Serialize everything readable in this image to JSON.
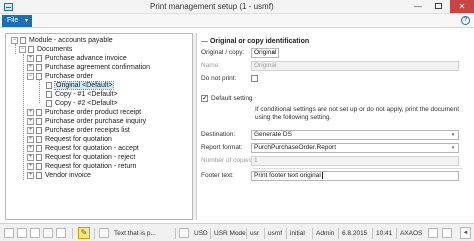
{
  "window": {
    "title": "Print management setup (1 - usmf)",
    "icons": {
      "app": "form-icon",
      "minimize": "minimize-icon",
      "maximize": "maximize-icon",
      "close": "close-icon"
    },
    "minimize_glyph": "—",
    "close_glyph": "✕"
  },
  "menu": {
    "file_label": "File",
    "file_caret": "▾",
    "help_glyph": "?"
  },
  "tree": {
    "items": [
      {
        "label": "Module - accounts payable",
        "toggle": "−"
      },
      {
        "label": "Documents",
        "toggle": "−"
      },
      {
        "label": "Purchase advance invoice",
        "toggle": "+"
      },
      {
        "label": "Purchase agreement confirmation",
        "toggle": "+"
      },
      {
        "label": "Purchase order",
        "toggle": "−"
      },
      {
        "label": "Original <Default>"
      },
      {
        "label": "Copy - #1 <Default>"
      },
      {
        "label": "Copy - #2 <Default>"
      },
      {
        "label": "Purchase order product receipt",
        "toggle": "+"
      },
      {
        "label": "Purchase order purchase inquiry",
        "toggle": "+"
      },
      {
        "label": "Purchase order receipts list",
        "toggle": "+"
      },
      {
        "label": "Request for quotation",
        "toggle": "+"
      },
      {
        "label": "Request for quotation - accept",
        "toggle": "+"
      },
      {
        "label": "Request for quotation - reject",
        "toggle": "+"
      },
      {
        "label": "Request for quotation - return",
        "toggle": "+"
      },
      {
        "label": "Vendor invoice",
        "toggle": "+"
      }
    ]
  },
  "detail": {
    "section_title": "Original or copy identification",
    "section_title_sep": "—",
    "original_copy": {
      "label": "Original / copy:",
      "value": "Original",
      "caret": "▾"
    },
    "name": {
      "label": "Name:",
      "value": "Original"
    },
    "do_not_print": {
      "label": "Do not print:",
      "checked": false
    },
    "default_setting": {
      "label": "Default setting",
      "checked": true
    },
    "info_text": "If conditional settings are not set up or do not apply, print the document using the following setting.",
    "destination": {
      "label": "Destination:",
      "value": "Generate DS",
      "caret": "▾"
    },
    "report_format": {
      "label": "Report format:",
      "value": "PurchPurchaseOrder.Report",
      "caret": "▾"
    },
    "number_of_copies": {
      "label": "Number of copies:",
      "value": "1"
    },
    "footer_text": {
      "label": "Footer text:",
      "value": "Print footer text original"
    }
  },
  "statusbar": {
    "pencil_glyph": "✎",
    "task_text": "Text that is p...",
    "fields": [
      "USD",
      "USR Model",
      "usr",
      "usmf",
      "initial",
      "Admin",
      "6.8.2015",
      "10:41",
      "AXAOS"
    ],
    "chevron": "◄"
  }
}
